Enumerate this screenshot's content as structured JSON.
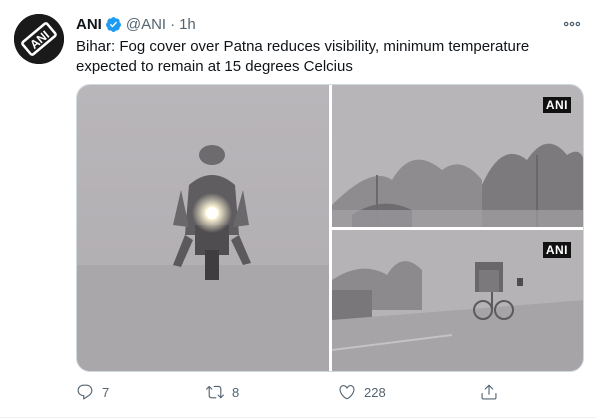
{
  "tweet": {
    "author_name": "ANI",
    "handle": "@ANI",
    "separator": "·",
    "time": "1h",
    "text": "Bihar: Fog cover over Patna reduces visibility, minimum temperature expected to remain at 15 degrees Celcius",
    "avatar_text": "ANI",
    "media": [
      {
        "badge": ""
      },
      {
        "badge": "ANI"
      },
      {
        "badge": "ANI"
      }
    ],
    "actions": {
      "reply_count": "7",
      "retweet_count": "8",
      "like_count": "228"
    }
  },
  "colors": {
    "text_primary": "#0f1419",
    "text_secondary": "#536471",
    "verified": "#1d9bf0",
    "border": "#cfd9de"
  },
  "icons": [
    "verified-badge-icon",
    "more-icon",
    "reply-icon",
    "retweet-icon",
    "like-icon",
    "share-icon"
  ]
}
